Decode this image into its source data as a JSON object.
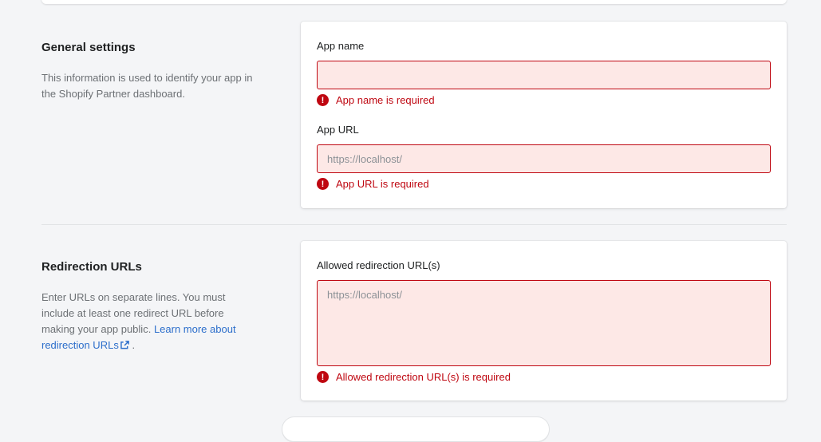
{
  "general": {
    "title": "General settings",
    "description": "This information is used to identify your app in the Shopify Partner dashboard.",
    "app_name": {
      "label": "App name",
      "value": "",
      "placeholder": "",
      "error": "App name is required"
    },
    "app_url": {
      "label": "App URL",
      "value": "",
      "placeholder": "https://localhost/",
      "error": "App URL is required"
    }
  },
  "redirection": {
    "title": "Redirection URLs",
    "description_text": "Enter URLs on separate lines. You must include at least one redirect URL before making your app public.",
    "link_text": "Learn more about redirection URLs",
    "trailing": ".",
    "allowed": {
      "label": "Allowed redirection URL(s)",
      "value": "",
      "placeholder": "https://localhost/",
      "error": "Allowed redirection URL(s) is required"
    }
  },
  "icons": {
    "error": "alert-circle-icon",
    "external": "external-link-icon"
  },
  "colors": {
    "critical": "#bf0711",
    "critical_fill": "#fde8e6",
    "link": "#2c6ecb",
    "background": "#f4f5f7"
  }
}
